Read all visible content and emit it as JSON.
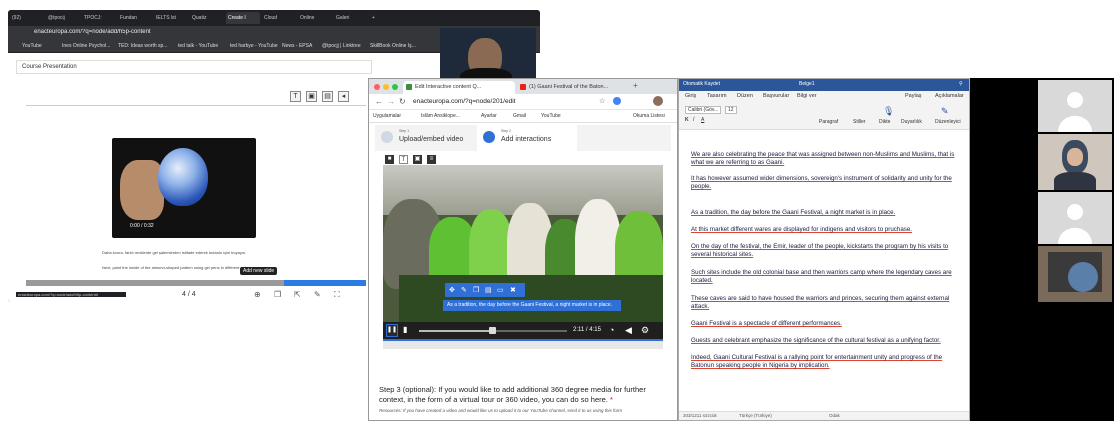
{
  "back_window": {
    "tabs": [
      "(92)",
      "@tpocij",
      "TPOCJ:",
      "Fundan",
      "IELTS lst",
      "Quatiz",
      "Create I",
      "Cloud",
      "Online",
      "Galeri",
      "+"
    ],
    "url": "enacteuropa.com/?q=node/add/h5p-content",
    "bookmarks": [
      "YouTube",
      "Ines Online Psychol...",
      "TED: Ideas worth sp...",
      "ted talk - YouTube",
      "ted harbye - YouTube",
      "News - EPSA",
      "@tpocjj | Linktree",
      "SkillBook Online Iş..."
    ],
    "course_label": "Course Presentation",
    "video_time": "0:00 / 0:32",
    "caption_tr": "Daha sonra, farklı renklerde gel şalemlerden istifade ederek butanin içini boyayın.",
    "caption_en": "Next, paint the inside of the almond-shaped pattern using gel pens in different colors.",
    "pager": "4 / 4",
    "tooltip": "Add new slide",
    "status_url": "enacteuropa.com/?q=node/add/h5p-content#"
  },
  "front_window": {
    "tabs": [
      "Edit Interactive content Q...",
      "(1) Gaani Festival of the Baton..."
    ],
    "url": "enacteuropa.com/?q=node/201/edit",
    "bookmarks": [
      "Uygulamalar",
      "İslâm Ansiklope...",
      "Ayarlar",
      "Gmail",
      "YouTube",
      "Okuma Listesi"
    ],
    "step1_small": "Step 1",
    "step1_label": "Upload/embed video",
    "step2_small": "Step 2",
    "step2_label": "Add interactions",
    "overlay_caption": "As a tradition, the day before the Gaani Festival, a night market is in place.",
    "time": "2:11 / 4:15",
    "step3": "Step 3 (optional): If you would like to add additional 360 degree media for further context, in the form of a virtual tour or 360 video, you can do so here.",
    "step3_required_mark": "*",
    "resources": "Resources: If you have created a video and would like us to upload it to our YouTube channel, send it to us using this form"
  },
  "word": {
    "title_left": "Otomatik Kaydet",
    "title_doc": "Belge1",
    "menu": [
      "Giriş",
      "Tasarım",
      "Düzen",
      "Başvurular",
      "Bilgi ver",
      "Paylaş",
      "Açıklamalar"
    ],
    "font": "Calibri (Göv...",
    "font_size": "12",
    "ribbon_labels": [
      "Paragraf",
      "Stiller",
      "Dikte",
      "Duyarlılık",
      "Düzenleyici"
    ],
    "paragraphs": [
      "We are also celebrating the peace that was assigned between non-Muslims and Muslims, that is what we are referring to as Gaani.",
      "It has however assumed wider dimensions, sovereign's instrument of solidarity and unity for the people.",
      "As a tradition, the day before the Gaani Festival, a night market is in place.",
      "At this market different wares are displayed for indigens and visitors to pruchase.",
      "On the day of the festival, the Emir, leader of the people, kickstarts the program by his visits to several historical sites.",
      "Such sites include the old colonial base and then warriors camp where the legendary caves are located.",
      "These caves are said to have housed the warriors and princes, securing them against external attack.",
      "Gaani Festival is a spectacle of different performances.",
      "Guests and celebrant emphasize the significance of the cultural festival as a unifying factor.",
      "Indeed, Gaani Cultural Festival is a rallying point for entertainment unity and progress of the Batonun speaking people in Nigeria by implication."
    ],
    "status_left": "203/1211 sözcük",
    "status_lang": "Türkçe (Türkiye)",
    "status_zoom": "Odak"
  },
  "colors": {
    "accent_blue": "#2f6fd6",
    "word_blue": "#2b579a",
    "spell_red": "#d43"
  }
}
